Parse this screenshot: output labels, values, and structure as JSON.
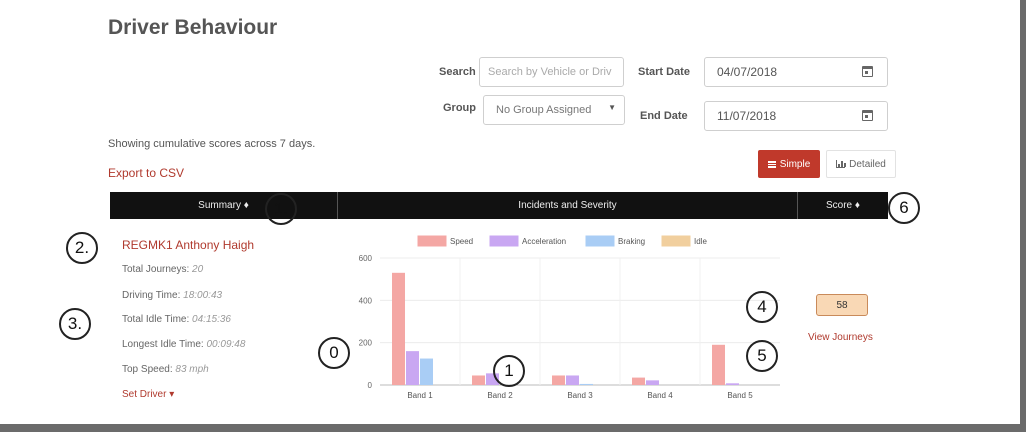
{
  "page": {
    "title": "Driver Behaviour",
    "info_text": "Showing cumulative scores across 7 days.",
    "export_label": "Export to CSV"
  },
  "filters": {
    "search_label": "Search",
    "search_placeholder": "Search by Vehicle or Driv",
    "group_label": "Group",
    "group_value": "No Group Assigned",
    "start_label": "Start Date",
    "start_value": "04/07/2018",
    "end_label": "End Date",
    "end_value": "11/07/2018"
  },
  "view_toggle": {
    "simple_label": "Simple",
    "detailed_label": "Detailed"
  },
  "table": {
    "headers": [
      "Summary ♦",
      "Incidents and Severity",
      "Score ♦"
    ]
  },
  "driver": {
    "name": "REGMK1 Anthony Haigh",
    "stats": [
      {
        "label": "Total Journeys:",
        "value": "20"
      },
      {
        "label": "Driving Time:",
        "value": "18:00:43"
      },
      {
        "label": "Total Idle Time:",
        "value": "04:15:36"
      },
      {
        "label": "Longest Idle Time:",
        "value": "00:09:48"
      },
      {
        "label": "Top Speed:",
        "value": "83 mph"
      }
    ],
    "set_driver": "Set Driver ▾",
    "score": "58",
    "view_journeys": "View Journeys"
  },
  "chart_data": {
    "type": "bar",
    "categories": [
      "Band 1",
      "Band 2",
      "Band 3",
      "Band 4",
      "Band 5"
    ],
    "series": [
      {
        "name": "Speed",
        "values": [
          530,
          45,
          45,
          35,
          190
        ],
        "color": "#f4a7a4"
      },
      {
        "name": "Acceleration",
        "values": [
          160,
          55,
          45,
          22,
          8
        ],
        "color": "#c9a7f2"
      },
      {
        "name": "Braking",
        "values": [
          125,
          0,
          5,
          0,
          0
        ],
        "color": "#a9cdf5"
      },
      {
        "name": "Idle",
        "values": [
          0,
          0,
          0,
          0,
          0
        ],
        "color": "#f1cf9e"
      }
    ],
    "yticks": [
      0,
      200,
      400,
      600
    ],
    "ylim": [
      0,
      600
    ],
    "grid": true,
    "legend": "top"
  },
  "callouts": [
    "1.",
    "2.",
    "3.",
    "4",
    "5",
    "6",
    "0",
    "1"
  ]
}
